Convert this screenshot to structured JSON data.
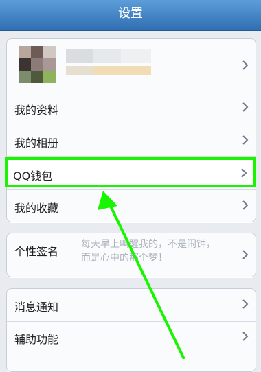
{
  "header": {
    "title": "设置"
  },
  "menu": {
    "my_profile": "我的资料",
    "my_album": "我的相册",
    "qq_wallet": "QQ钱包",
    "my_favorites": "我的收藏",
    "signature_label": "个性签名",
    "signature_text": "每天早上叫醒我的，不是闹钟，而是心中的那个梦！",
    "notifications": "消息通知",
    "accessibility": "辅助功能"
  },
  "colors": {
    "header_top": "#5d9dd9",
    "header_bottom": "#2f6fb2",
    "highlight": "#19f500"
  }
}
